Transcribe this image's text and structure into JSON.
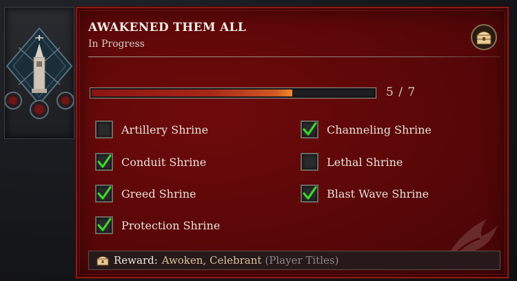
{
  "achievement": {
    "title": "AWAKENED THEM ALL",
    "status": "In Progress",
    "badge_icon": "treasure-chest-icon"
  },
  "progress": {
    "current": 5,
    "total": 7,
    "text": "5 / 7",
    "fill_fraction": 0.71
  },
  "checklist": [
    {
      "label": "Artillery Shrine",
      "done": false
    },
    {
      "label": "Channeling Shrine",
      "done": true
    },
    {
      "label": "Conduit Shrine",
      "done": true
    },
    {
      "label": "Lethal Shrine",
      "done": false
    },
    {
      "label": "Greed Shrine",
      "done": true
    },
    {
      "label": "Blast Wave Shrine",
      "done": true
    },
    {
      "label": "Protection Shrine",
      "done": true
    }
  ],
  "reward": {
    "label": "Reward:",
    "value": "Awoken, Celebrant",
    "type": "(Player Titles)",
    "icon": "treasure-chest-icon"
  },
  "colors": {
    "panel_red": "#5a0708",
    "border_red": "#8d1a15",
    "check_green": "#3fd62b",
    "progress_orange": "#f08a2c",
    "reward_gold": "#d8c19a"
  }
}
